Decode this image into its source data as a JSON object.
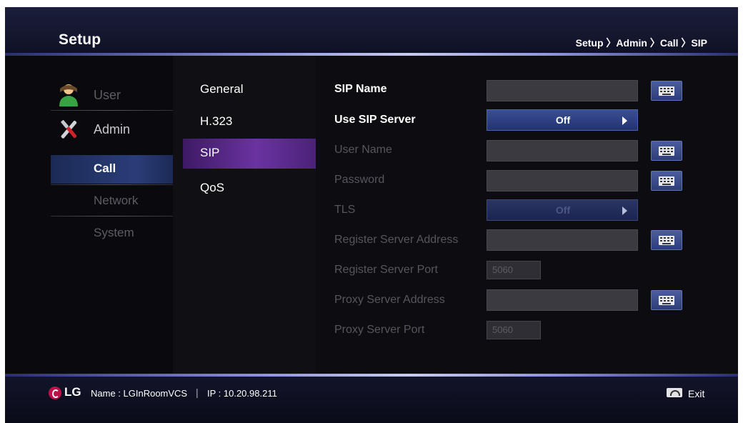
{
  "header": {
    "title": "Setup",
    "breadcrumb": "Setup 〉Admin 〉Call 〉SIP"
  },
  "nav": {
    "user": "User",
    "admin": "Admin",
    "call": "Call",
    "network": "Network",
    "system": "System"
  },
  "submenu": {
    "general": "General",
    "h323": "H.323",
    "sip": "SIP",
    "qos": "QoS"
  },
  "form": {
    "sip_name": {
      "label": "SIP Name",
      "value": ""
    },
    "use_sip_server": {
      "label": "Use SIP Server",
      "value": "Off"
    },
    "user_name": {
      "label": "User Name",
      "value": ""
    },
    "password": {
      "label": "Password",
      "value": ""
    },
    "tls": {
      "label": "TLS",
      "value": "Off"
    },
    "register_server_address": {
      "label": "Register Server Address",
      "value": ""
    },
    "register_server_port": {
      "label": "Register Server Port",
      "value": "5060"
    },
    "proxy_server_address": {
      "label": "Proxy Server Address",
      "value": ""
    },
    "proxy_server_port": {
      "label": "Proxy Server Port",
      "value": "5060"
    }
  },
  "footer": {
    "brand": "LG",
    "name": "Name : LGInRoomVCS",
    "separator": "|",
    "ip": "IP : 10.20.98.211",
    "exit": "Exit"
  },
  "colors": {
    "accent_selected_submenu": "#6a33a1",
    "accent_selected_nav": "#2a3d78",
    "brand": "#c0104a"
  }
}
